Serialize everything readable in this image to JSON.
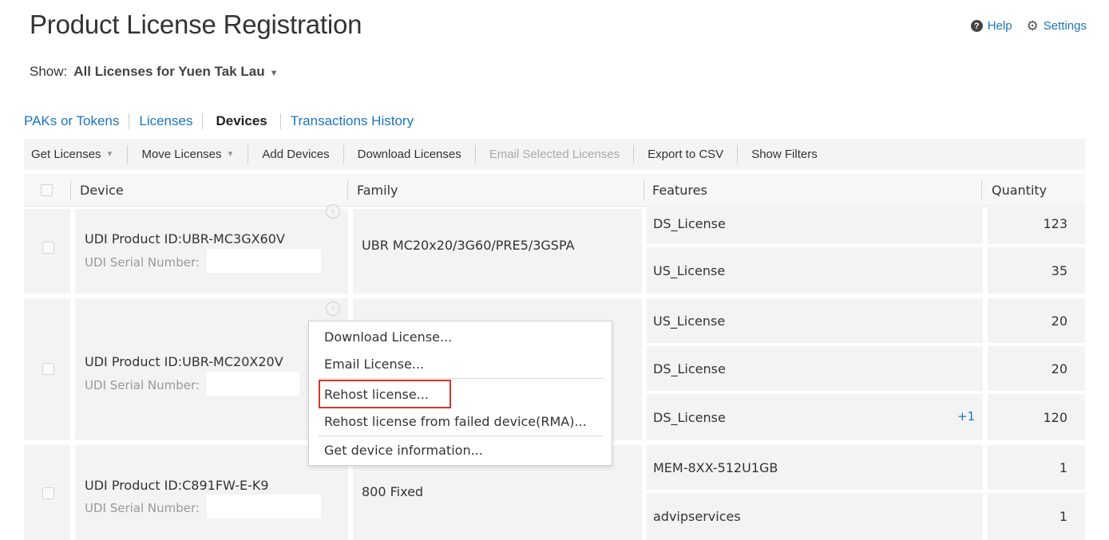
{
  "header": {
    "title": "Product License Registration",
    "help_label": "Help",
    "settings_label": "Settings"
  },
  "show": {
    "label": "Show:",
    "value": "All Licenses for Yuen Tak Lau"
  },
  "tabs": [
    {
      "label": "PAKs or Tokens",
      "active": false
    },
    {
      "label": "Licenses",
      "active": false
    },
    {
      "label": "Devices",
      "active": true
    },
    {
      "label": "Transactions History",
      "active": false
    }
  ],
  "toolbar": {
    "get_licenses": "Get Licenses",
    "move_licenses": "Move Licenses",
    "add_devices": "Add Devices",
    "download_licenses": "Download Licenses",
    "email_selected": "Email Selected Licenses",
    "export_csv": "Export to CSV",
    "show_filters": "Show Filters"
  },
  "columns": {
    "device": "Device",
    "family": "Family",
    "features": "Features",
    "quantity": "Quantity"
  },
  "devices": [
    {
      "product_id": "UDI Product ID:UBR-MC3GX60V",
      "serial_label": "UDI Serial Number:",
      "family": "UBR MC20x20/3G60/PRE5/3GSPA",
      "features": [
        {
          "name": "DS_License",
          "quantity": "123"
        },
        {
          "name": "US_License",
          "quantity": "35"
        }
      ]
    },
    {
      "product_id": "UDI Product ID:UBR-MC20X20V",
      "serial_label": "UDI Serial Number:",
      "family": "",
      "features": [
        {
          "name": "US_License",
          "quantity": "20"
        },
        {
          "name": "DS_License",
          "quantity": "20"
        },
        {
          "name": "DS_License",
          "quantity": "120",
          "extra": "+1"
        }
      ]
    },
    {
      "product_id": "UDI Product ID:C891FW-E-K9",
      "serial_label": "UDI Serial Number:",
      "family": "800 Fixed",
      "features": [
        {
          "name": "MEM-8XX-512U1GB",
          "quantity": "1"
        },
        {
          "name": "advipservices",
          "quantity": "1"
        }
      ]
    }
  ],
  "context_menu": {
    "items": [
      "Download License...",
      "Email License...",
      "Rehost license...",
      "Rehost license from failed device(RMA)...",
      "Get device information..."
    ],
    "highlighted": "Rehost license...",
    "highlight_color": "#d9342b"
  },
  "colors": {
    "link": "#1c75bc",
    "cell_bg": "#f3f3f3",
    "toolbar_bg": "#f4f4f4"
  }
}
